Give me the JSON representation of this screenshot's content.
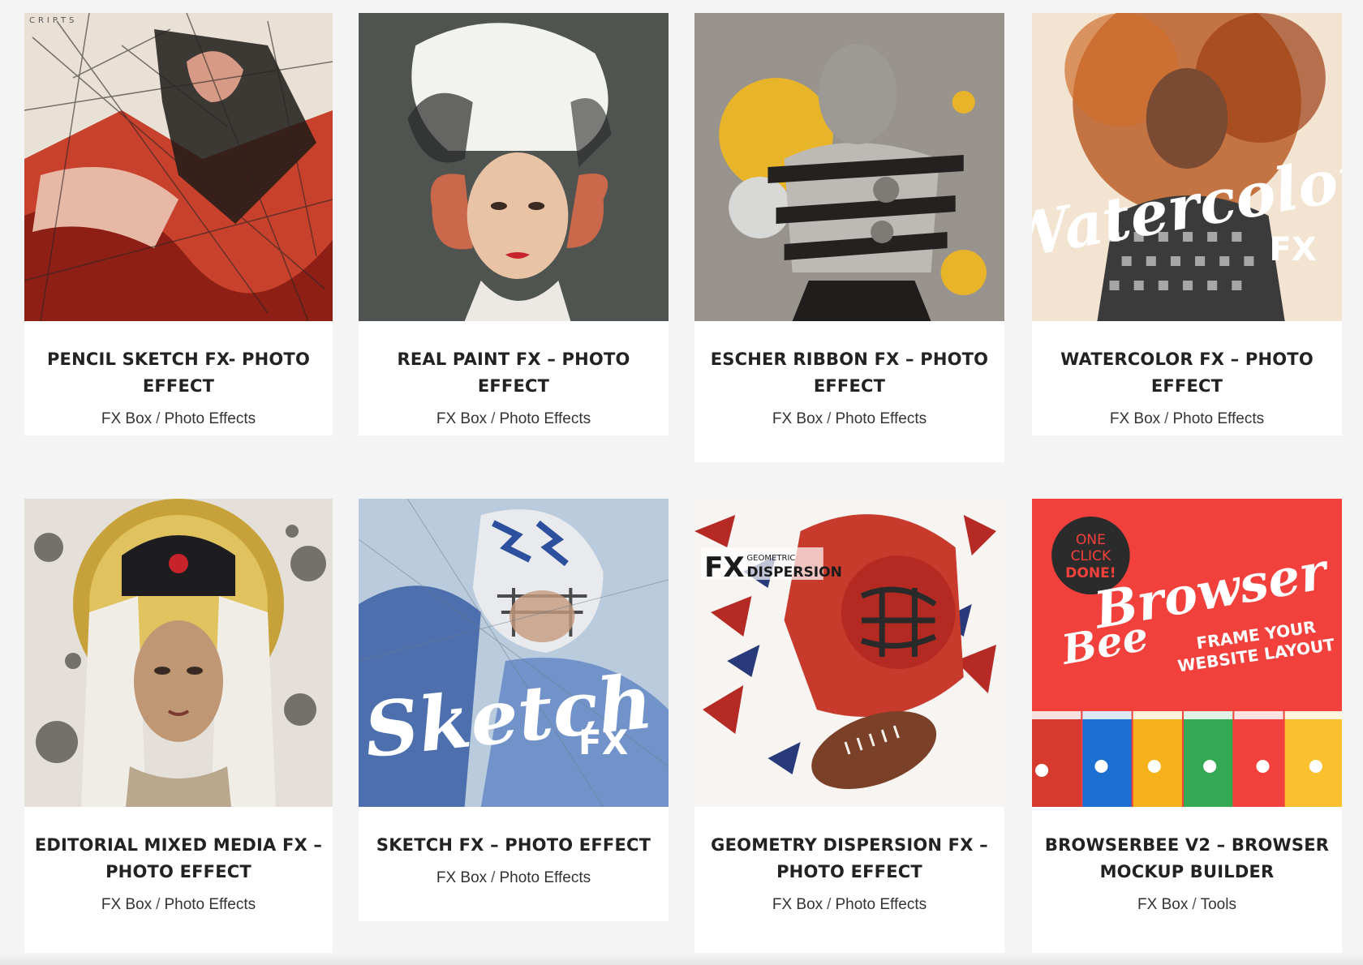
{
  "products": [
    {
      "title": "PENCIL SKETCH FX- PHOTO EFFECT",
      "categories": [
        "FX Box",
        "Photo Effects"
      ],
      "thumb_icon": "pencil-sketch-thumbnail",
      "thumb_text": "CRIPTS"
    },
    {
      "title": "REAL PAINT FX – PHOTO EFFECT",
      "categories": [
        "FX Box",
        "Photo Effects"
      ],
      "thumb_icon": "real-paint-thumbnail"
    },
    {
      "title": "ESCHER RIBBON FX – PHOTO EFFECT",
      "categories": [
        "FX Box",
        "Photo Effects"
      ],
      "thumb_icon": "escher-ribbon-thumbnail"
    },
    {
      "title": "WATERCOLOR FX – PHOTO EFFECT",
      "categories": [
        "FX Box",
        "Photo Effects"
      ],
      "thumb_icon": "watercolor-thumbnail",
      "thumb_text": "Watercolor",
      "thumb_subtext": "FX"
    },
    {
      "title": "EDITORIAL MIXED MEDIA FX – PHOTO EFFECT",
      "categories": [
        "FX Box",
        "Photo Effects"
      ],
      "thumb_icon": "editorial-mixed-media-thumbnail"
    },
    {
      "title": "SKETCH FX – PHOTO EFFECT",
      "categories": [
        "FX Box",
        "Photo Effects"
      ],
      "thumb_icon": "sketch-thumbnail",
      "thumb_text": "Sketch",
      "thumb_subtext": "FX"
    },
    {
      "title": "GEOMETRY DISPERSION FX – PHOTO EFFECT",
      "categories": [
        "FX Box",
        "Photo Effects"
      ],
      "thumb_icon": "geometry-dispersion-thumbnail",
      "thumb_text": "FX",
      "thumb_subtext": "GEOMETRIC",
      "thumb_subtext2": "DISPERSION"
    },
    {
      "title": "BROWSERBEE V2 – BROWSER MOCKUP BUILDER",
      "categories": [
        "FX Box",
        "Tools"
      ],
      "thumb_icon": "browserbee-thumbnail",
      "thumb_text": "Browser",
      "thumb_subtext": "Bee",
      "thumb_subtext2": "FRAME YOUR",
      "thumb_subtext3": "WEBSITE LAYOUT",
      "badge_line1": "ONE",
      "badge_line2": "CLICK",
      "badge_line3": "DONE!"
    }
  ],
  "separator": "/",
  "colors": {
    "page_bg": "#f4f4f4",
    "card_bg": "#ffffff",
    "title": "#222222",
    "category": "#333333"
  }
}
